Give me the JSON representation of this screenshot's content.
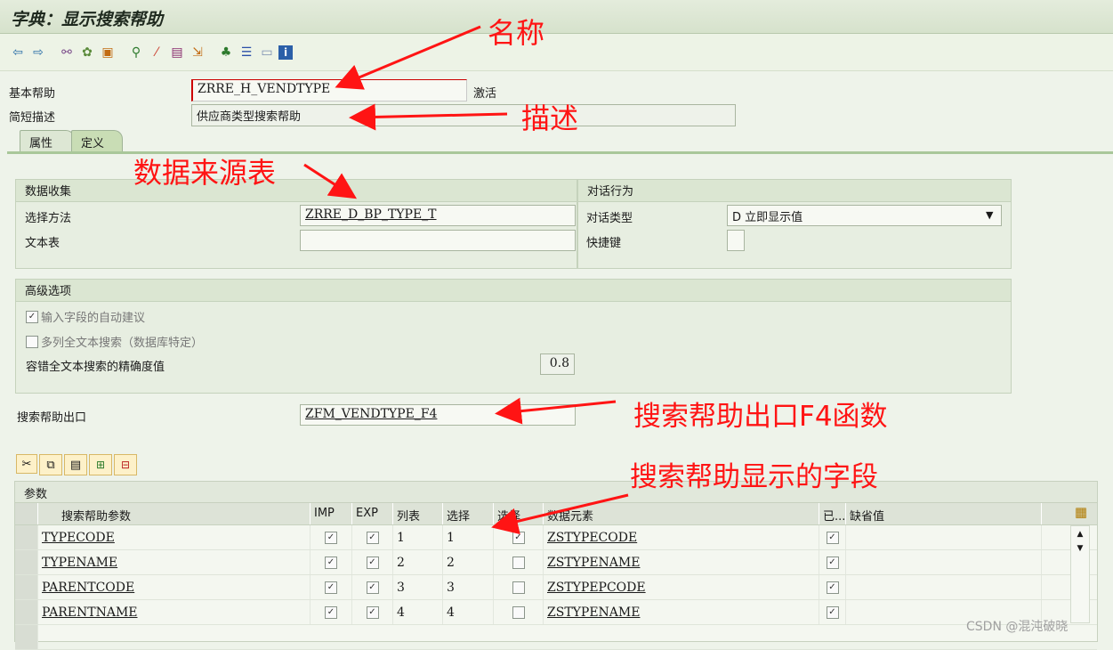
{
  "title": "字典：显示搜索帮助",
  "toolbar": {
    "icons": [
      "back-icon",
      "forward-icon",
      "glasses-icon",
      "other-object-icon",
      "activate-icon",
      "where-used-icon",
      "wand-icon",
      "display-object-list-icon",
      "navigate-icon",
      "hierarchy-icon",
      "list-icon",
      "layout-icon",
      "info-icon"
    ]
  },
  "header": {
    "basic_help_label": "基本帮助",
    "basic_help_value": "ZRRE_H_VENDTYPE",
    "status": "激活",
    "short_desc_label": "简短描述",
    "short_desc_value": "供应商类型搜索帮助"
  },
  "tabs": [
    {
      "label": "属性"
    },
    {
      "label": "定义"
    }
  ],
  "data_collection": {
    "title": "数据收集",
    "selection_method_label": "选择方法",
    "selection_method_value": "ZRRE_D_BP_TYPE_T",
    "text_table_label": "文本表",
    "text_table_value": ""
  },
  "dialog": {
    "title": "对话行为",
    "dialog_type_label": "对话类型",
    "dialog_type_value": "D 立即显示值",
    "hotkey_label": "快捷键",
    "hotkey_value": ""
  },
  "advanced": {
    "title": "高级选项",
    "auto_suggest_label": "输入字段的自动建议",
    "auto_suggest_checked": true,
    "fulltext_label": "多列全文本搜索（数据库特定）",
    "fulltext_checked": false,
    "accuracy_label": "容错全文本搜索的精确度值",
    "accuracy_value": "0.8"
  },
  "exit": {
    "label": "搜索帮助出口",
    "value": "ZFM_VENDTYPE_F4"
  },
  "params": {
    "title": "参数",
    "columns": [
      "搜索帮助参数",
      "IMP",
      "EXP",
      "列表",
      "选择",
      "选择",
      "数据元素",
      "已...",
      "缺省值"
    ],
    "rows": [
      {
        "name": "TYPECODE",
        "imp": true,
        "exp": true,
        "lpos": "1",
        "spos": "1",
        "sdis": true,
        "elem": "ZSTYPECODE",
        "mod": true,
        "def": ""
      },
      {
        "name": "TYPENAME",
        "imp": true,
        "exp": true,
        "lpos": "2",
        "spos": "2",
        "sdis": false,
        "elem": "ZSTYPENAME",
        "mod": true,
        "def": ""
      },
      {
        "name": "PARENTCODE",
        "imp": true,
        "exp": true,
        "lpos": "3",
        "spos": "3",
        "sdis": false,
        "elem": "ZSTYPEPCODE",
        "mod": true,
        "def": ""
      },
      {
        "name": "PARENTNAME",
        "imp": true,
        "exp": true,
        "lpos": "4",
        "spos": "4",
        "sdis": false,
        "elem": "ZSTYPENAME",
        "mod": true,
        "def": ""
      }
    ]
  },
  "annotations": {
    "name": "名称",
    "desc": "描述",
    "source": "数据来源表",
    "exit": "搜索帮助出口F4函数",
    "fields": "搜索帮助显示的字段"
  },
  "watermark": "CSDN @混沌破晓",
  "colors": {
    "annotation": "#ff1414",
    "background": "#eef3ea"
  }
}
